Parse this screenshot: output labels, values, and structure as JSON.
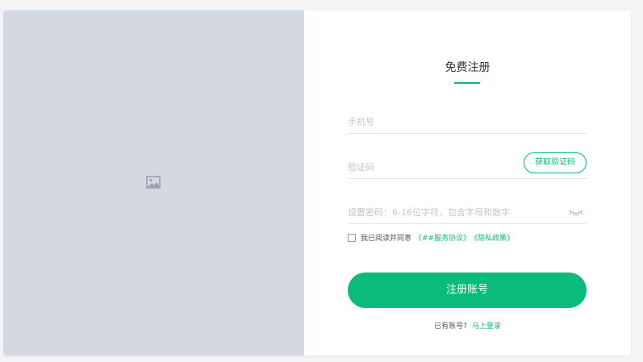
{
  "form": {
    "title": "免费注册",
    "phone_placeholder": "手机号",
    "code_placeholder": "验证码",
    "get_code_label": "获取验证码",
    "password_placeholder": "设置密码：6-16位字符，包含字母和数字",
    "agree_text": "我已阅读并同意",
    "service_link": "《##服务协议》",
    "privacy_link": "《隐私政策》",
    "submit_label": "注册账号",
    "have_account_text": "已有账号?",
    "login_link": "马上登录"
  },
  "icons": {
    "left_image": "image-placeholder-icon",
    "password_toggle": "eye-closed-icon"
  },
  "colors": {
    "accent": "#0bbb7a",
    "left_panel": "#d3d8e1",
    "page_bg": "#f4f4f7"
  }
}
